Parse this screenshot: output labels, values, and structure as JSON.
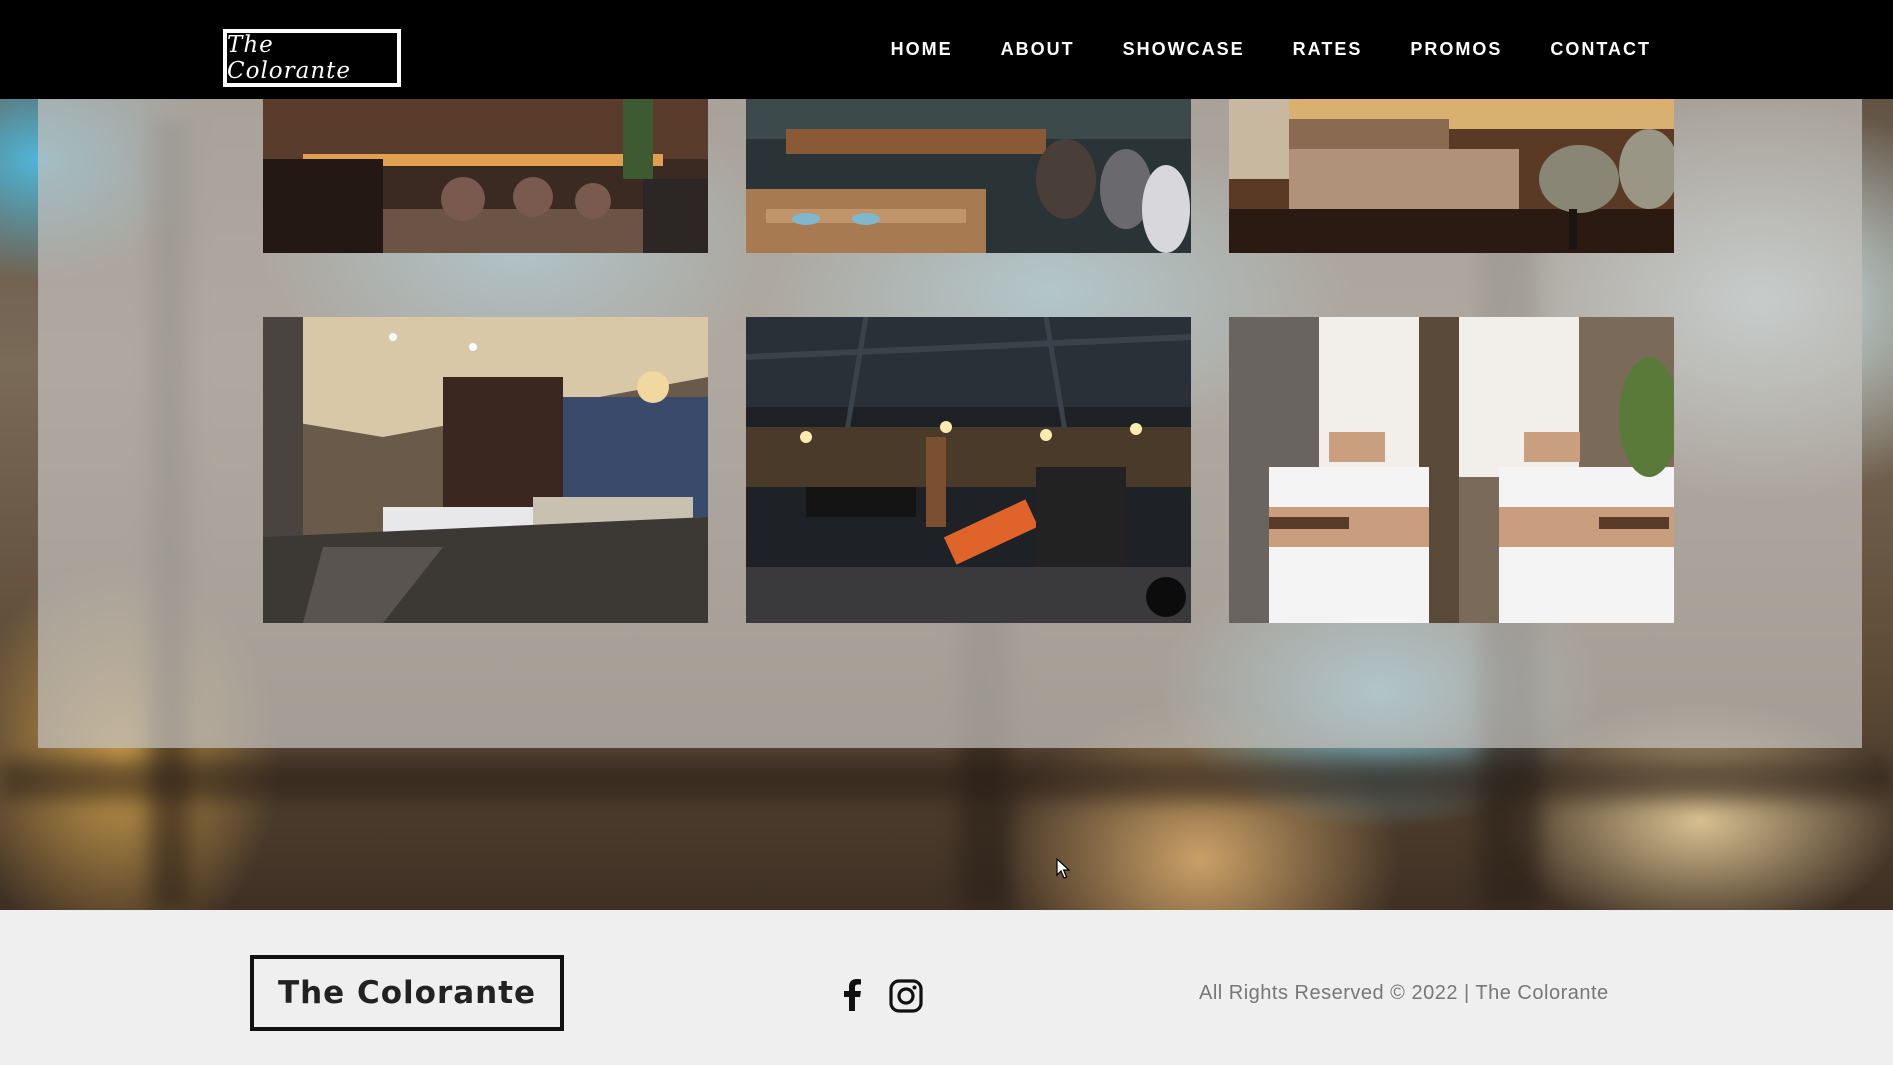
{
  "header": {
    "logo_text": "The Colorante",
    "nav": [
      "HOME",
      "ABOUT",
      "SHOWCASE",
      "RATES",
      "PROMOS",
      "CONTACT"
    ]
  },
  "gallery": {
    "photos": [
      {
        "subject": "restaurant-bar"
      },
      {
        "subject": "cafe-dining"
      },
      {
        "subject": "lounge-sofa"
      },
      {
        "subject": "dining-room"
      },
      {
        "subject": "gym"
      },
      {
        "subject": "spa-beds"
      }
    ]
  },
  "footer": {
    "logo_text": "The Colorante",
    "social": [
      "facebook-icon",
      "instagram-icon"
    ],
    "copyright": "All Rights Reserved © 2022 | The Colorante"
  },
  "colors": {
    "header_bg": "#000000",
    "footer_bg": "#efefef",
    "text_muted": "#777777"
  }
}
